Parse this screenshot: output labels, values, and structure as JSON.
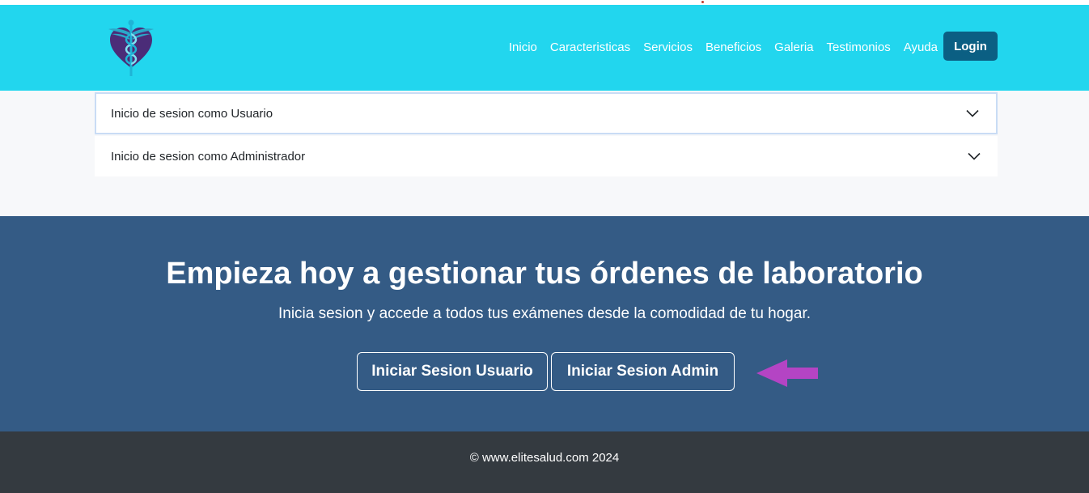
{
  "nav": {
    "links": [
      "Inicio",
      "Caracteristicas",
      "Servicios",
      "Beneficios",
      "Galeria",
      "Testimonios",
      "Ayuda"
    ],
    "login_label": "Login"
  },
  "accordion": {
    "items": [
      "Inicio de sesion como Usuario",
      "Inicio de sesion como Administrador"
    ]
  },
  "cta": {
    "title": "Empieza hoy a gestionar tus órdenes de laboratorio",
    "subtitle": "Inicia sesion y accede a todos tus exámenes desde la comodidad de tu hogar.",
    "user_button": "Iniciar Sesion Usuario",
    "admin_button": "Iniciar Sesion Admin"
  },
  "footer": {
    "text": "© www.elitesalud.com 2024"
  },
  "icons": {
    "logo": "caduceus-heart-logo",
    "accordion_toggle": "chevron-down-icon",
    "pointer": "arrow-left-icon"
  },
  "colors": {
    "navbar_bg": "#22d6ee",
    "login_bg": "#0b5f83",
    "cta_bg": "#345b85",
    "footer_bg": "#343a40",
    "arrow": "#b444c4"
  }
}
